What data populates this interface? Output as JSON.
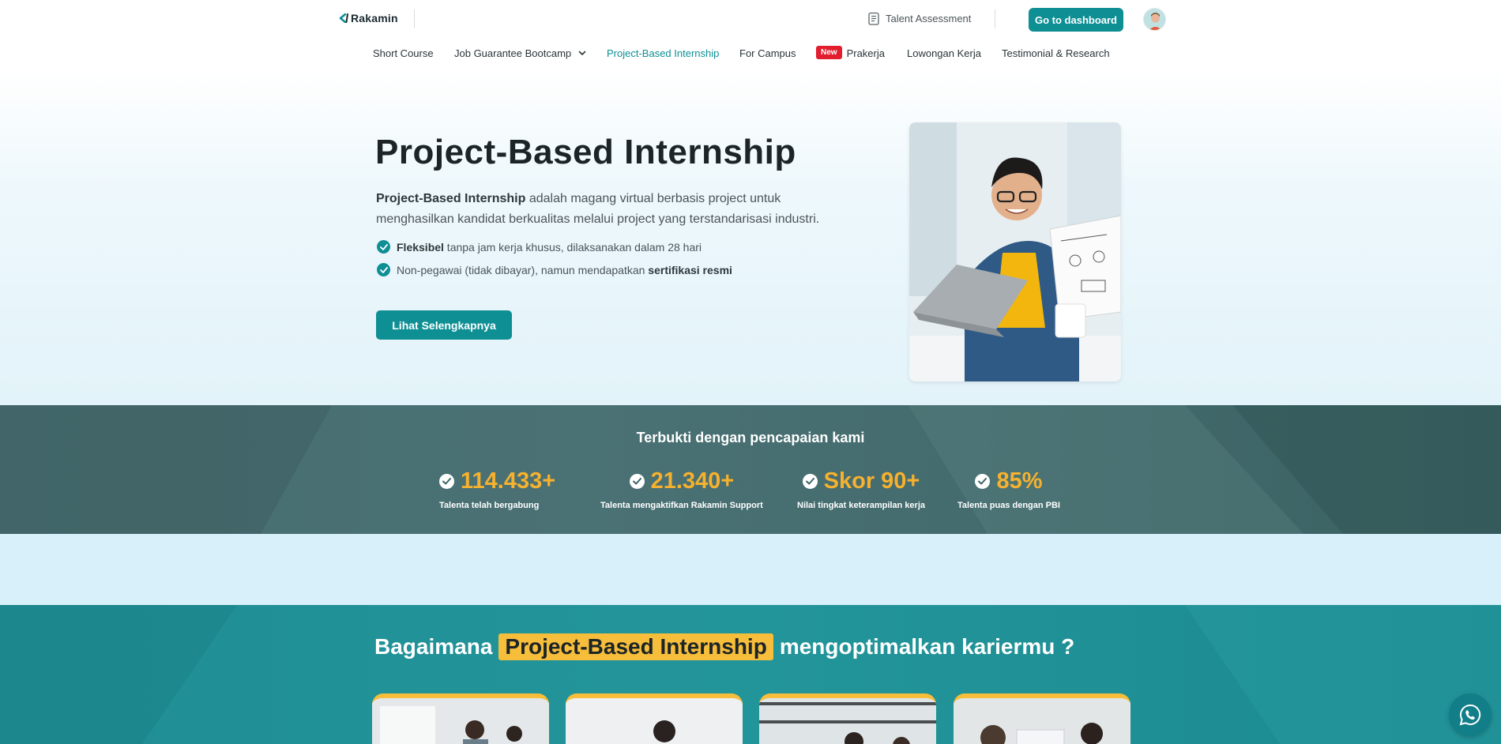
{
  "header": {
    "logo_text": "Rakamin",
    "talent_assessment": "Talent Assessment",
    "dashboard_button": "Go to dashboard"
  },
  "nav": {
    "items": [
      {
        "label": "Short Course"
      },
      {
        "label": "Job Guarantee Bootcamp",
        "has_dropdown": true
      },
      {
        "label": "Project-Based Internship",
        "active": true
      },
      {
        "label": "For Campus"
      },
      {
        "label": "Prakerja",
        "badge": "New"
      },
      {
        "label": "Lowongan Kerja"
      },
      {
        "label": "Testimonial & Research"
      }
    ]
  },
  "hero": {
    "title": "Project-Based Internship",
    "desc_bold": "Project-Based Internship",
    "desc_line1": " adalah magang virtual berbasis project untuk",
    "desc_line2": "menghasilkan kandidat berkualitas melalui project yang terstandarisasi industri.",
    "bullets": [
      {
        "bold": "Fleksibel",
        "text": " tanpa jam kerja khusus, dilaksanakan dalam 28 hari"
      },
      {
        "text": "Non-pegawai (tidak dibayar), namun mendapatkan ",
        "bold": "sertifikasi resmi"
      }
    ],
    "cta": "Lihat Selengkapnya"
  },
  "stats": {
    "title": "Terbukti dengan pencapaian kami",
    "items": [
      {
        "value": "114.433+",
        "label": "Talenta telah bergabung"
      },
      {
        "value": "21.340+",
        "label": "Talenta mengaktifkan Rakamin Support"
      },
      {
        "value": "Skor 90+",
        "label": "Nilai tingkat keterampilan kerja"
      },
      {
        "value": "85%",
        "label": "Talenta puas dengan PBI"
      }
    ]
  },
  "how": {
    "title_pre": "Bagaimana",
    "title_highlight": "Project-Based Internship",
    "title_post": "mengoptimalkan kariermu ?"
  },
  "colors": {
    "primary": "#0e8f94",
    "accent": "#f6b12e",
    "badge_red": "#e11d2e"
  }
}
